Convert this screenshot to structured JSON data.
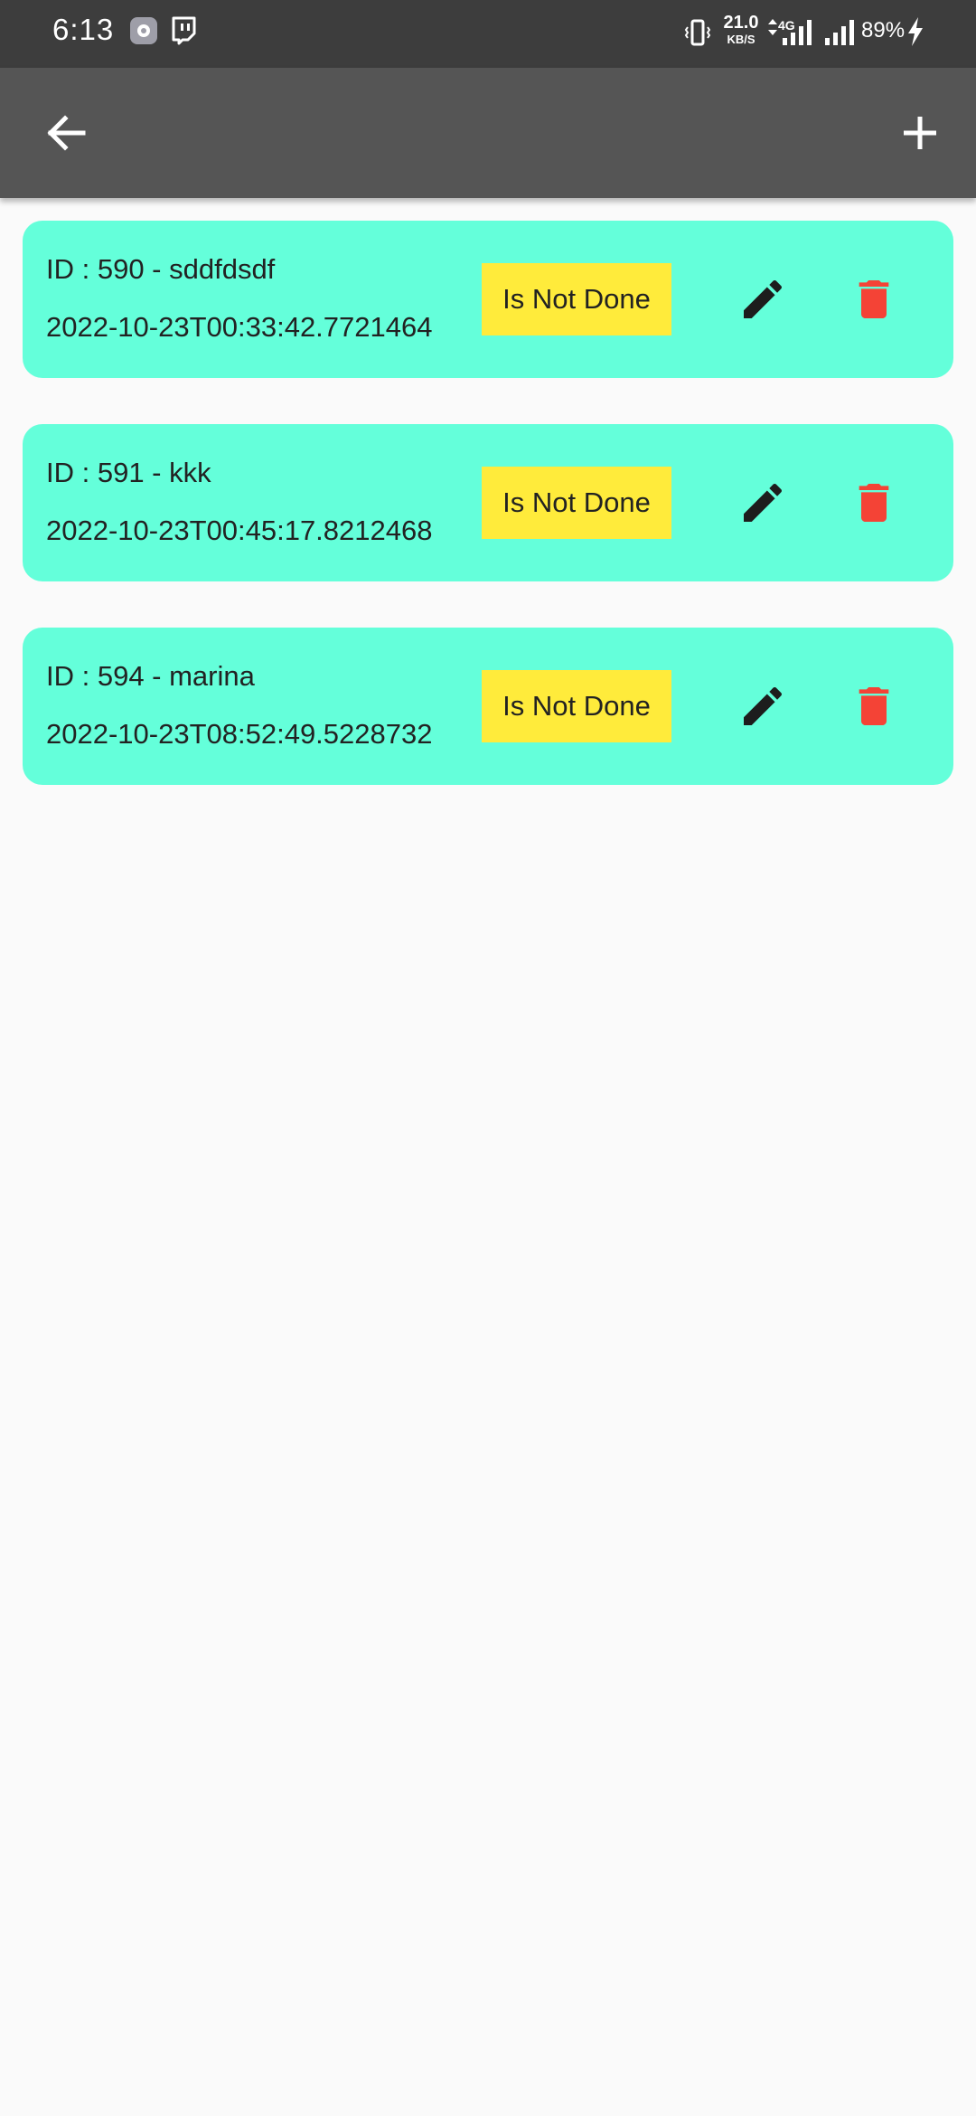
{
  "status_bar": {
    "time": "6:13",
    "net_speed_value": "21.0",
    "net_speed_unit": "KB/S",
    "network_type": "4G",
    "battery": "89%"
  },
  "app_bar": {
    "back_icon": "arrow-back-icon",
    "add_icon": "plus-icon"
  },
  "todos": [
    {
      "title": "ID : 590 - sddfdsdf",
      "date": "2022-10-23T00:33:42.7721464",
      "status": "Is Not Done"
    },
    {
      "title": "ID : 591 - kkk",
      "date": "2022-10-23T00:45:17.8212468",
      "status": "Is Not Done"
    },
    {
      "title": "ID : 594 - marina",
      "date": "2022-10-23T08:52:49.5228732",
      "status": "Is Not Done"
    }
  ],
  "colors": {
    "card_background": "#64ffda",
    "status_button": "#ffeb3b",
    "delete_icon": "#f44336",
    "edit_icon": "#1d1d1d",
    "app_bar": "#555555",
    "status_bar": "#3d3d3d"
  }
}
